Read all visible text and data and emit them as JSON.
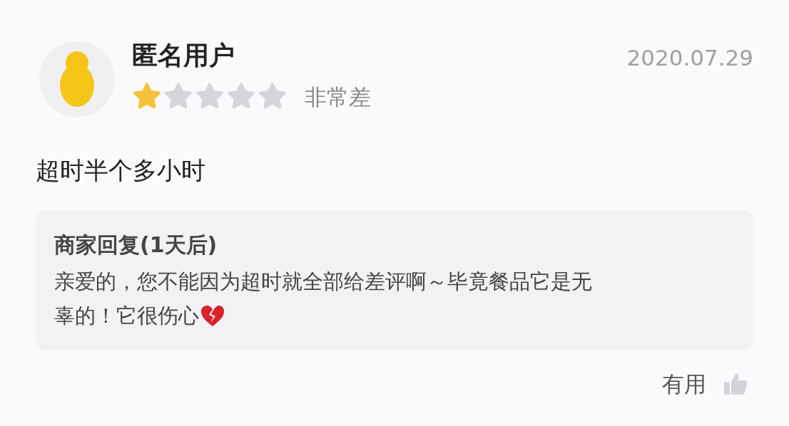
{
  "review": {
    "user": "匿名用户",
    "date": "2020.07.29",
    "stars": 1,
    "rating_label": "非常差",
    "text": "超时半个多小时"
  },
  "reply": {
    "title": "商家回复(1天后)",
    "lines": [
      "亲爱的，您不能因为超时就全部给差评啊～毕竟餐品它是无",
      "辜的！它很伤心"
    ]
  },
  "footer": {
    "useful_label": "有用",
    "liked": false
  }
}
